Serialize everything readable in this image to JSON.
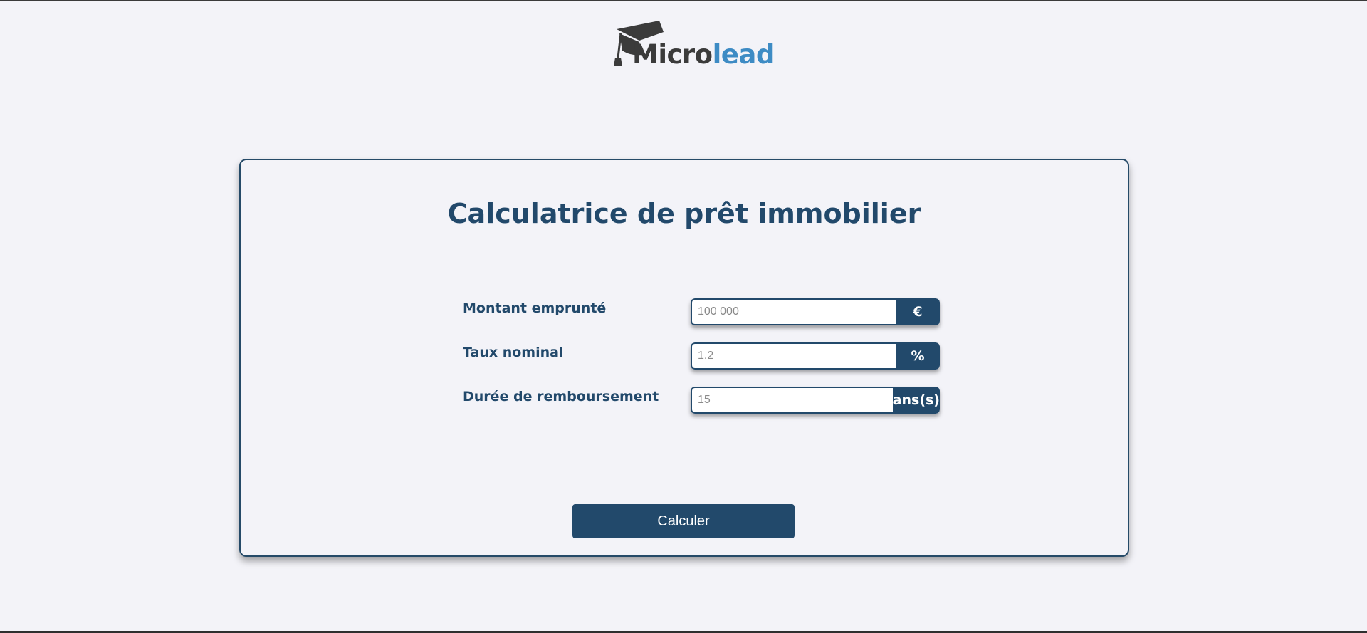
{
  "logo": {
    "name_part1": "Micro",
    "name_part2": "lead",
    "colors": {
      "dark": "#3b3b3b",
      "accent": "#3d8bc4"
    },
    "icon": "graduation-cap-icon"
  },
  "calculator": {
    "title": "Calculatrice de prêt immobilier",
    "fields": [
      {
        "label": "Montant emprunté",
        "placeholder": "100 000",
        "unit": "€"
      },
      {
        "label": "Taux nominal",
        "placeholder": "1.2",
        "unit": "%"
      },
      {
        "label": "Durée de remboursement",
        "placeholder": "15",
        "unit": "ans(s)"
      }
    ],
    "submit_label": "Calculer"
  },
  "theme": {
    "primary": "#22496b",
    "background": "#f3f3f8"
  }
}
